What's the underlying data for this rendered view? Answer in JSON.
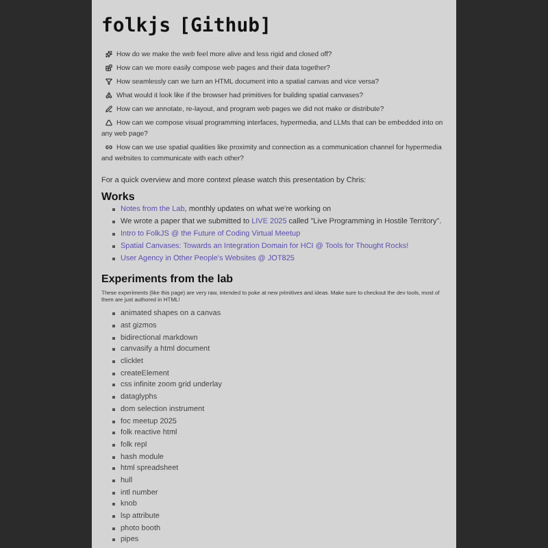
{
  "title": {
    "text": "folkjs",
    "link": "[Github]"
  },
  "questions": [
    {
      "kind": "sparkle",
      "text": "How do we make the web feel more alive and less rigid and closed off?"
    },
    {
      "kind": "blocks",
      "text": "How can we more easily compose web pages and their data together?"
    },
    {
      "kind": "funnel",
      "text": "How seamlessly can we turn an HTML document into a spatial canvas and vice versa?"
    },
    {
      "kind": "shape",
      "text": "What would it look like if the browser had primitives for building spatial canvases?"
    },
    {
      "kind": "pen",
      "text": "How can we annotate, re-layout, and program web pages we did not make or distribute?"
    },
    {
      "kind": "triangle",
      "text": "How can we compose visual programming interfaces, hypermedia, and LLMs that can be embedded into on any web page?"
    },
    {
      "kind": "link",
      "text": "How can we use spatial qualities like proximity and connection as a communication channel for hypermedia and websites to communicate with each other?"
    }
  ],
  "intro": "For a quick overview and more context please watch this presentation by Chris:",
  "works": {
    "heading": "Works",
    "items": [
      [
        {
          "text": "Notes from the Lab",
          "link": true
        },
        {
          "text": ", monthly updates on what we're working on",
          "link": false
        }
      ],
      [
        {
          "text": "We wrote a paper that we submitted to ",
          "link": false
        },
        {
          "text": "LIVE 2025",
          "link": true
        },
        {
          "text": " called \"Live Programming in Hostile Territory\".",
          "link": false
        }
      ],
      [
        {
          "text": "Intro to FolkJS @ the Future of Coding Virtual Meetup",
          "link": true
        }
      ],
      [
        {
          "text": "Spatial Canvases: Towards an Integration Domain for HCI @ Tools for Thought Rocks!",
          "link": true
        }
      ],
      [
        {
          "text": "User Agency in Other People's Websites @ JOT825",
          "link": true
        }
      ]
    ]
  },
  "experiments": {
    "heading": "Experiments from the lab",
    "note": "These experiments (like this page) are very raw, intended to poke at new primitives and ideas. Make sure to checkout the dev tools, most of them are just authored in HTML!",
    "items": [
      "animated shapes on a canvas",
      "ast gizmos",
      "bidirectional markdown",
      "canvasify a html document",
      "clicklet",
      "createElement",
      "css infinite zoom grid underlay",
      "dataglyphs",
      "dom selection instrument",
      "foc meetup 2025",
      "folk reactive html",
      "folk repl",
      "hash module",
      "html spreadsheet",
      "hull",
      "intl number",
      "knob",
      "lsp attribute",
      "photo booth",
      "pipes"
    ]
  }
}
